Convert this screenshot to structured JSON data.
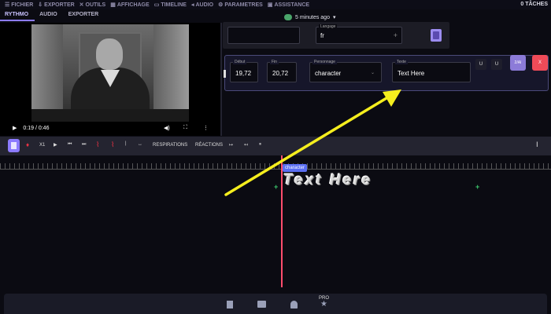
{
  "menubar": {
    "items": [
      {
        "label": "FICHIER",
        "icon": "menu-icon"
      },
      {
        "label": "EXPORTER",
        "icon": "export-icon"
      },
      {
        "label": "OUTILS",
        "icon": "tools-icon"
      },
      {
        "label": "AFFICHAGE",
        "icon": "display-icon"
      },
      {
        "label": "TIMELINE",
        "icon": "timeline-icon"
      },
      {
        "label": "AUDIO",
        "icon": "audio-icon"
      },
      {
        "label": "PARAMETRES",
        "icon": "settings-icon"
      },
      {
        "label": "ASSISTANCE",
        "icon": "help-icon"
      }
    ],
    "tasks": "0 TÂCHES"
  },
  "tabs": [
    "RYTHMO",
    "AUDIO",
    "EXPORTER"
  ],
  "save_status": "5 minutes ago",
  "video": {
    "time": "0:19 / 0:46"
  },
  "language": {
    "label": "Langage",
    "value": "fr"
  },
  "line": {
    "debut_label": "Début",
    "debut_value": "19,72",
    "fin_label": "Fin",
    "fin_value": "20,72",
    "perso_label": "Personnage",
    "perso_value": "character",
    "texte_label": "Texte",
    "texte_value": "Text Here",
    "btn_u1": "U",
    "btn_u2": "U",
    "btn_ai": "2/AI",
    "btn_del": "X"
  },
  "toolbar": {
    "x1": "X1",
    "respirations": "RESPIRATIONS",
    "reactions": "RÉACTIONS"
  },
  "timeline": {
    "character_badge": "character",
    "rythmo_text": "Text Here"
  },
  "bottombar": {
    "pro": "PRO"
  },
  "colors": {
    "accent": "#8c7bff",
    "playhead": "#ff4d6d",
    "delete": "#ef4b58",
    "arrow": "#f5ee1e"
  }
}
